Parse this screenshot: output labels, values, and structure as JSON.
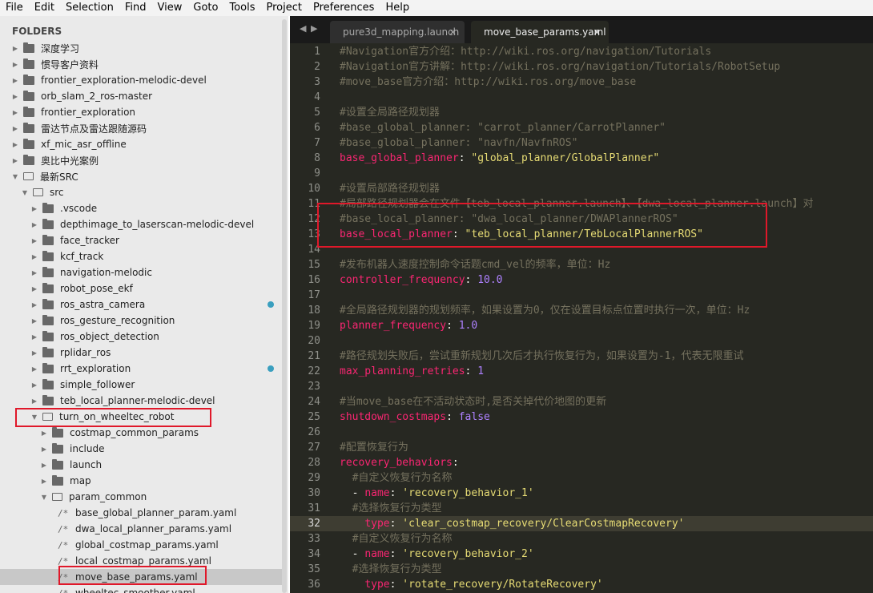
{
  "menu": [
    "File",
    "Edit",
    "Selection",
    "Find",
    "View",
    "Goto",
    "Tools",
    "Project",
    "Preferences",
    "Help"
  ],
  "sidebar": {
    "title": "FOLDERS",
    "items": [
      {
        "label": "深度学习",
        "depth": 0,
        "kind": "folder",
        "open": false
      },
      {
        "label": "惯导客户资料",
        "depth": 0,
        "kind": "folder",
        "open": false
      },
      {
        "label": "frontier_exploration-melodic-devel",
        "depth": 0,
        "kind": "folder",
        "open": false
      },
      {
        "label": "orb_slam_2_ros-master",
        "depth": 0,
        "kind": "folder",
        "open": false
      },
      {
        "label": "frontier_exploration",
        "depth": 0,
        "kind": "folder",
        "open": false
      },
      {
        "label": "雷达节点及雷达跟随源码",
        "depth": 0,
        "kind": "folder",
        "open": false
      },
      {
        "label": "xf_mic_asr_offline",
        "depth": 0,
        "kind": "folder",
        "open": false
      },
      {
        "label": "奥比中光案例",
        "depth": 0,
        "kind": "folder",
        "open": false
      },
      {
        "label": "最新SRC",
        "depth": 0,
        "kind": "folder",
        "open": true
      },
      {
        "label": "src",
        "depth": 1,
        "kind": "folder",
        "open": true
      },
      {
        "label": ".vscode",
        "depth": 2,
        "kind": "folder",
        "open": false
      },
      {
        "label": "depthimage_to_laserscan-melodic-devel",
        "depth": 2,
        "kind": "folder",
        "open": false
      },
      {
        "label": "face_tracker",
        "depth": 2,
        "kind": "folder",
        "open": false
      },
      {
        "label": "kcf_track",
        "depth": 2,
        "kind": "folder",
        "open": false
      },
      {
        "label": "navigation-melodic",
        "depth": 2,
        "kind": "folder",
        "open": false
      },
      {
        "label": "robot_pose_ekf",
        "depth": 2,
        "kind": "folder",
        "open": false
      },
      {
        "label": "ros_astra_camera",
        "depth": 2,
        "kind": "folder",
        "open": false,
        "dot": true
      },
      {
        "label": "ros_gesture_recognition",
        "depth": 2,
        "kind": "folder",
        "open": false
      },
      {
        "label": "ros_object_detection",
        "depth": 2,
        "kind": "folder",
        "open": false
      },
      {
        "label": "rplidar_ros",
        "depth": 2,
        "kind": "folder",
        "open": false
      },
      {
        "label": "rrt_exploration",
        "depth": 2,
        "kind": "folder",
        "open": false,
        "dot": true
      },
      {
        "label": "simple_follower",
        "depth": 2,
        "kind": "folder",
        "open": false
      },
      {
        "label": "teb_local_planner-melodic-devel",
        "depth": 2,
        "kind": "folder",
        "open": false
      },
      {
        "label": "turn_on_wheeltec_robot",
        "depth": 2,
        "kind": "folder",
        "open": true
      },
      {
        "label": "costmap_common_params",
        "depth": 3,
        "kind": "folder",
        "open": false
      },
      {
        "label": "include",
        "depth": 3,
        "kind": "folder",
        "open": false
      },
      {
        "label": "launch",
        "depth": 3,
        "kind": "folder",
        "open": false
      },
      {
        "label": "map",
        "depth": 3,
        "kind": "folder",
        "open": false
      },
      {
        "label": "param_common",
        "depth": 3,
        "kind": "folder",
        "open": true
      },
      {
        "label": "base_global_planner_param.yaml",
        "depth": 4,
        "kind": "file"
      },
      {
        "label": "dwa_local_planner_params.yaml",
        "depth": 4,
        "kind": "file"
      },
      {
        "label": "global_costmap_params.yaml",
        "depth": 4,
        "kind": "file"
      },
      {
        "label": "local_costmap_params.yaml",
        "depth": 4,
        "kind": "file"
      },
      {
        "label": "move_base_params.yaml",
        "depth": 4,
        "kind": "file",
        "selected": true
      },
      {
        "label": "wheeltec_smoother.yaml",
        "depth": 4,
        "kind": "file"
      }
    ]
  },
  "tabs": [
    {
      "label": "pure3d_mapping.launch",
      "active": false
    },
    {
      "label": "move_base_params.yaml",
      "active": true
    }
  ],
  "editor": {
    "current_line": 32,
    "lines": [
      [
        [
          "c-cm",
          "#Navigation官方介绍：http://wiki.ros.org/navigation/Tutorials"
        ]
      ],
      [
        [
          "c-cm",
          "#Navigation官方讲解：http://wiki.ros.org/navigation/Tutorials/RobotSetup"
        ]
      ],
      [
        [
          "c-cm",
          "#move_base官方介绍：http://wiki.ros.org/move_base"
        ]
      ],
      [],
      [
        [
          "c-cm",
          "#设置全局路径规划器"
        ]
      ],
      [
        [
          "c-cm",
          "#base_global_planner: \"carrot_planner/CarrotPlanner\""
        ]
      ],
      [
        [
          "c-cm",
          "#base_global_planner: \"navfn/NavfnROS\""
        ]
      ],
      [
        [
          "c-key",
          "base_global_planner"
        ],
        [
          "c-pl",
          ": "
        ],
        [
          "c-str",
          "\"global_planner/GlobalPlanner\""
        ]
      ],
      [],
      [
        [
          "c-cm",
          "#设置局部路径规划器"
        ]
      ],
      [
        [
          "c-cm",
          "#局部路径规划器会在文件【teb_local_planner.launch】、【dwa_local_planner.launch】对"
        ]
      ],
      [
        [
          "c-cm",
          "#base_local_planner: \"dwa_local_planner/DWAPlannerROS\""
        ]
      ],
      [
        [
          "c-key",
          "base_local_planner"
        ],
        [
          "c-pl",
          ": "
        ],
        [
          "c-str",
          "\"teb_local_planner/TebLocalPlannerROS\""
        ]
      ],
      [],
      [
        [
          "c-cm",
          "#发布机器人速度控制命令话题cmd_vel的频率，单位：Hz"
        ]
      ],
      [
        [
          "c-key",
          "controller_frequency"
        ],
        [
          "c-pl",
          ": "
        ],
        [
          "c-num",
          "10.0"
        ]
      ],
      [],
      [
        [
          "c-cm",
          "#全局路径规划器的规划频率，如果设置为0，仅在设置目标点位置时执行一次，单位：Hz"
        ]
      ],
      [
        [
          "c-key",
          "planner_frequency"
        ],
        [
          "c-pl",
          ": "
        ],
        [
          "c-num",
          "1.0"
        ]
      ],
      [],
      [
        [
          "c-cm",
          "#路径规划失败后，尝试重新规划几次后才执行恢复行为，如果设置为-1，代表无限重试"
        ]
      ],
      [
        [
          "c-key",
          "max_planning_retries"
        ],
        [
          "c-pl",
          ": "
        ],
        [
          "c-num",
          "1"
        ]
      ],
      [],
      [
        [
          "c-cm",
          "#当move_base在不活动状态时,是否关掉代价地图的更新"
        ]
      ],
      [
        [
          "c-key",
          "shutdown_costmaps"
        ],
        [
          "c-pl",
          ": "
        ],
        [
          "c-num",
          "false"
        ]
      ],
      [],
      [
        [
          "c-cm",
          "#配置恢复行为"
        ]
      ],
      [
        [
          "c-key",
          "recovery_behaviors"
        ],
        [
          "c-pl",
          ":"
        ]
      ],
      [
        [
          "c-pl",
          "  "
        ],
        [
          "c-cm",
          "#自定义恢复行为名称"
        ]
      ],
      [
        [
          "c-pl",
          "  - "
        ],
        [
          "c-key",
          "name"
        ],
        [
          "c-pl",
          ": "
        ],
        [
          "c-str",
          "'recovery_behavior_1'"
        ]
      ],
      [
        [
          "c-pl",
          "  "
        ],
        [
          "c-cm",
          "#选择恢复行为类型"
        ]
      ],
      [
        [
          "c-pl",
          "    "
        ],
        [
          "c-key",
          "type"
        ],
        [
          "c-pl",
          ": "
        ],
        [
          "c-str",
          "'clear_costmap_recovery/ClearCostmapRecovery'"
        ]
      ],
      [
        [
          "c-pl",
          "  "
        ],
        [
          "c-cm",
          "#自定义恢复行为名称"
        ]
      ],
      [
        [
          "c-pl",
          "  - "
        ],
        [
          "c-key",
          "name"
        ],
        [
          "c-pl",
          ": "
        ],
        [
          "c-str",
          "'recovery_behavior_2'"
        ]
      ],
      [
        [
          "c-pl",
          "  "
        ],
        [
          "c-cm",
          "#选择恢复行为类型"
        ]
      ],
      [
        [
          "c-pl",
          "    "
        ],
        [
          "c-key",
          "type"
        ],
        [
          "c-pl",
          ": "
        ],
        [
          "c-str",
          "'rotate_recovery/RotateRecovery'"
        ]
      ]
    ]
  }
}
